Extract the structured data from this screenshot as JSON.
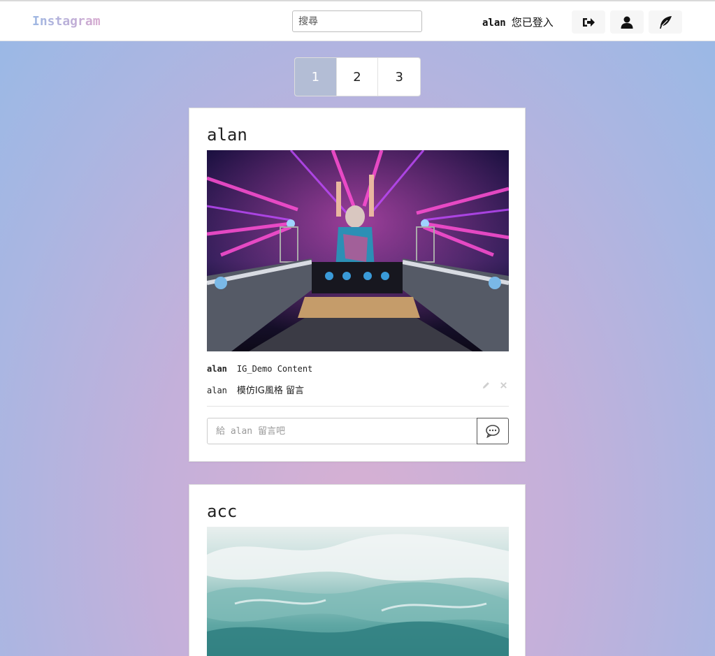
{
  "navbar": {
    "brand": "Instagram",
    "search_placeholder": "搜尋",
    "username": "alan",
    "status_text": "您已登入"
  },
  "pagination": {
    "pages": [
      "1",
      "2",
      "3"
    ],
    "active": "1"
  },
  "posts": [
    {
      "author": "alan",
      "image_desc": "dj-concert-photo",
      "caption_author": "alan",
      "caption": "IG_Demo Content",
      "comments": [
        {
          "author": "alan",
          "text": "模仿IG風格 留言"
        }
      ],
      "comment_placeholder": "給 alan 留言吧"
    },
    {
      "author": "acc",
      "image_desc": "ocean-wave-photo"
    }
  ],
  "colors": {
    "accent_active_page": "#b3bdd5",
    "bg_top": "#98b9e6",
    "bg_bottom": "#d7b0d3"
  }
}
